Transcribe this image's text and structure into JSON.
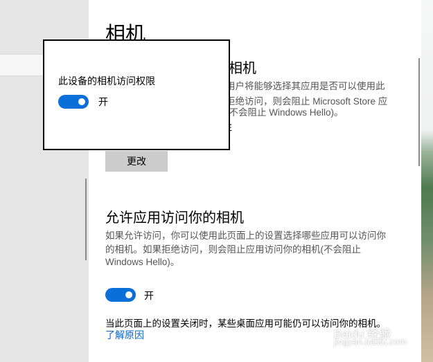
{
  "page": {
    "title": "相机"
  },
  "device_section": {
    "title": "相机",
    "description_lines": [
      "用户将能够选择其应用是否可以使用此",
      "拒绝访问，则会阻止 Microsoft Store 应",
      "(不会阻止 Windows Hello)。",
      "E"
    ],
    "change_button": "更改"
  },
  "app_section": {
    "title": "允许应用访问你的相机",
    "description_lines": [
      "如果允许访问，你可以使用此页面上的设置选择哪些应用可以访问你",
      "的相机。如果拒绝访问，则会阻止应用访问你的相机(不会阻止",
      "Windows Hello)。"
    ],
    "toggle_state": "开",
    "note": "当此页面上的设置关闭时，某些桌面应用可能仍可以访问你的相机。",
    "learn_more": "了解原因"
  },
  "popup": {
    "label": "此设备的相机访问权限",
    "toggle_state": "开"
  },
  "watermark": {
    "text": "Baidu 经验",
    "sub": "jingyan.baidu.com"
  },
  "colors": {
    "accent": "#0a6fd8",
    "link": "#0a63c9"
  }
}
